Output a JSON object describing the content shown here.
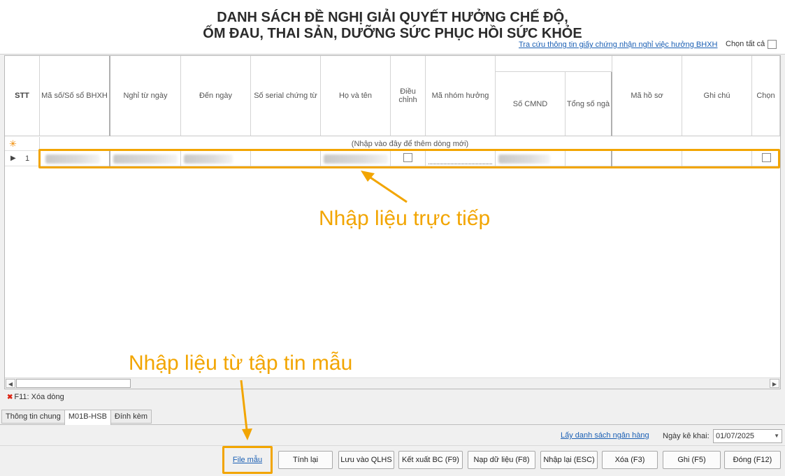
{
  "header": {
    "title_line1": "DANH SÁCH ĐỀ NGHỊ GIẢI QUYẾT HƯỞNG CHẾ ĐỘ,",
    "title_line2": "ỐM ĐAU, THAI SẢN, DƯỠNG SỨC PHỤC HỒI SỨC KHỎE",
    "lookup_link": "Tra cứu thông tin giấy chứng nhận nghỉ việc hưởng BHXH",
    "select_all_label": "Chọn tất cả"
  },
  "grid": {
    "columns": {
      "stt": "STT",
      "ma_so": "Mã số/Số sổ BHXH",
      "nghi_tu": "Nghỉ từ ngày",
      "den_ngay": "Đến ngày",
      "serial": "Số serial chứng từ",
      "ho_ten": "Họ và tên",
      "dieu_chinh_1": "Điều",
      "dieu_chinh_2": "chỉnh",
      "ma_nhom": "Mã nhóm hưởng",
      "so_cmnd": "Số CMND",
      "tong_so": "Tổng số ngà",
      "ma_ho_so": "Mã hồ sơ",
      "ghi_chu": "Ghi chú",
      "chon": "Chọn"
    },
    "new_row_hint": "(Nhập vào đây để thêm dòng mới)",
    "rows": [
      {
        "stt": "1"
      }
    ]
  },
  "shortcut": {
    "delete_row": "F11: Xóa dòng"
  },
  "tabs": [
    "Thông tin chung",
    "M01B-HSB",
    "Đính kèm"
  ],
  "active_tab": "M01B-HSB",
  "footer": {
    "bank_link": "Lấy danh sách ngân hàng",
    "date_label": "Ngày kê khai:",
    "date_value": "01/07/2025",
    "file_template_link": "File mẫu",
    "buttons": {
      "recalc": "Tính lại",
      "save_qlhs": "Lưu vào QLHS",
      "export": "Kết xuất BC (F9)",
      "load": "Nạp dữ liệu (F8)",
      "reenter": "Nhập lại (ESC)",
      "delete": "Xóa (F3)",
      "save": "Ghi (F5)",
      "close": "Đóng (F12)"
    }
  },
  "annotations": {
    "direct_entry": "Nhập liệu trực tiếp",
    "template_entry": "Nhập liệu từ tập tin mẫu",
    "color": "#f2a500"
  }
}
